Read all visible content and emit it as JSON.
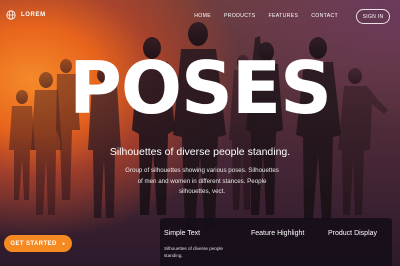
{
  "brand": {
    "name": "LOREM",
    "icon": "globe-icon"
  },
  "nav": {
    "links": [
      "HOME",
      "PRODUCTS",
      "FEATURES",
      "CONTACT"
    ],
    "signin_label": "SIGN IN"
  },
  "hero": {
    "title": "POSES",
    "subtitle": "Silhouettes of diverse people standing.",
    "description": "Group of silhouettes showing various poses. Silhouettes of men and women in different stances. People silhouettes, vect.",
    "cta_label": "GET STARTED",
    "cta_icon": "chevron-right-icon"
  },
  "features": {
    "items": [
      {
        "title": "Simple Text",
        "text": "Silhouettes of diverse people standing."
      },
      {
        "title": "Feature Highlight"
      },
      {
        "title": "Product Display"
      }
    ]
  },
  "colors": {
    "accent": "#f58a22",
    "panel": "#140e18",
    "background": "#2a1a2c"
  }
}
